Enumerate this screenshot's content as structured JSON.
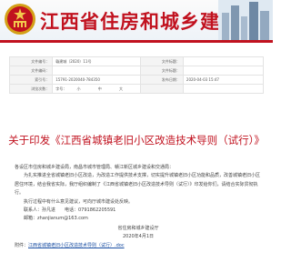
{
  "header": {
    "site_title": "江西省住房和城乡建设厅",
    "brand_color": "#c1121f"
  },
  "meta": {
    "rows": [
      {
        "k1": "文件编号：",
        "v1": "赣建城（2020）11号",
        "k2": "文件标题：",
        "v2": ""
      },
      {
        "k1": "文件编码：",
        "v1": "",
        "k2": "文件标题：",
        "v2": ""
      },
      {
        "k1": "索引号：",
        "v1": "15791-2020040-784350",
        "k2": "发布日期：",
        "v2": "2020-04-03 15:47"
      },
      {
        "k1": "浏览次数：",
        "v1": "",
        "k2": "",
        "v2": ""
      }
    ],
    "font_size_label": "字号：",
    "font_sizes": [
      "小",
      "中",
      "大"
    ]
  },
  "document": {
    "title": "关于印发《江西省城镇老旧小区改造技术导则（试行）》",
    "salutation": "各设区市住房和城乡建设局，南昌市城市管理局、赣江新区城乡建设和交通局：",
    "para1": "为扎实推进全省城镇老旧小区改造，为改造工作提供技术支撑，切实提升城镇老旧小区功能和品质，改善城镇老旧小区居住环境，结合我省实际，我厅组织编制了《江西省城镇老旧小区改造技术导则（试行）》印发给你们，请结合实际贯彻执行。",
    "para2": "执行过程中有什么意见建议，可向厅城市建设处反映。",
    "contact_name": "联系人：孙凡进　　电话：0791862205591",
    "contact_email": "邮箱：zhanjianum@163.com",
    "issuer": "省住房和城乡建设厅",
    "date": "2020年4月1日",
    "attachment_label": "附件：",
    "attachment_file": "江西省城镇老旧小区改造技术导则（试行）.doc"
  }
}
